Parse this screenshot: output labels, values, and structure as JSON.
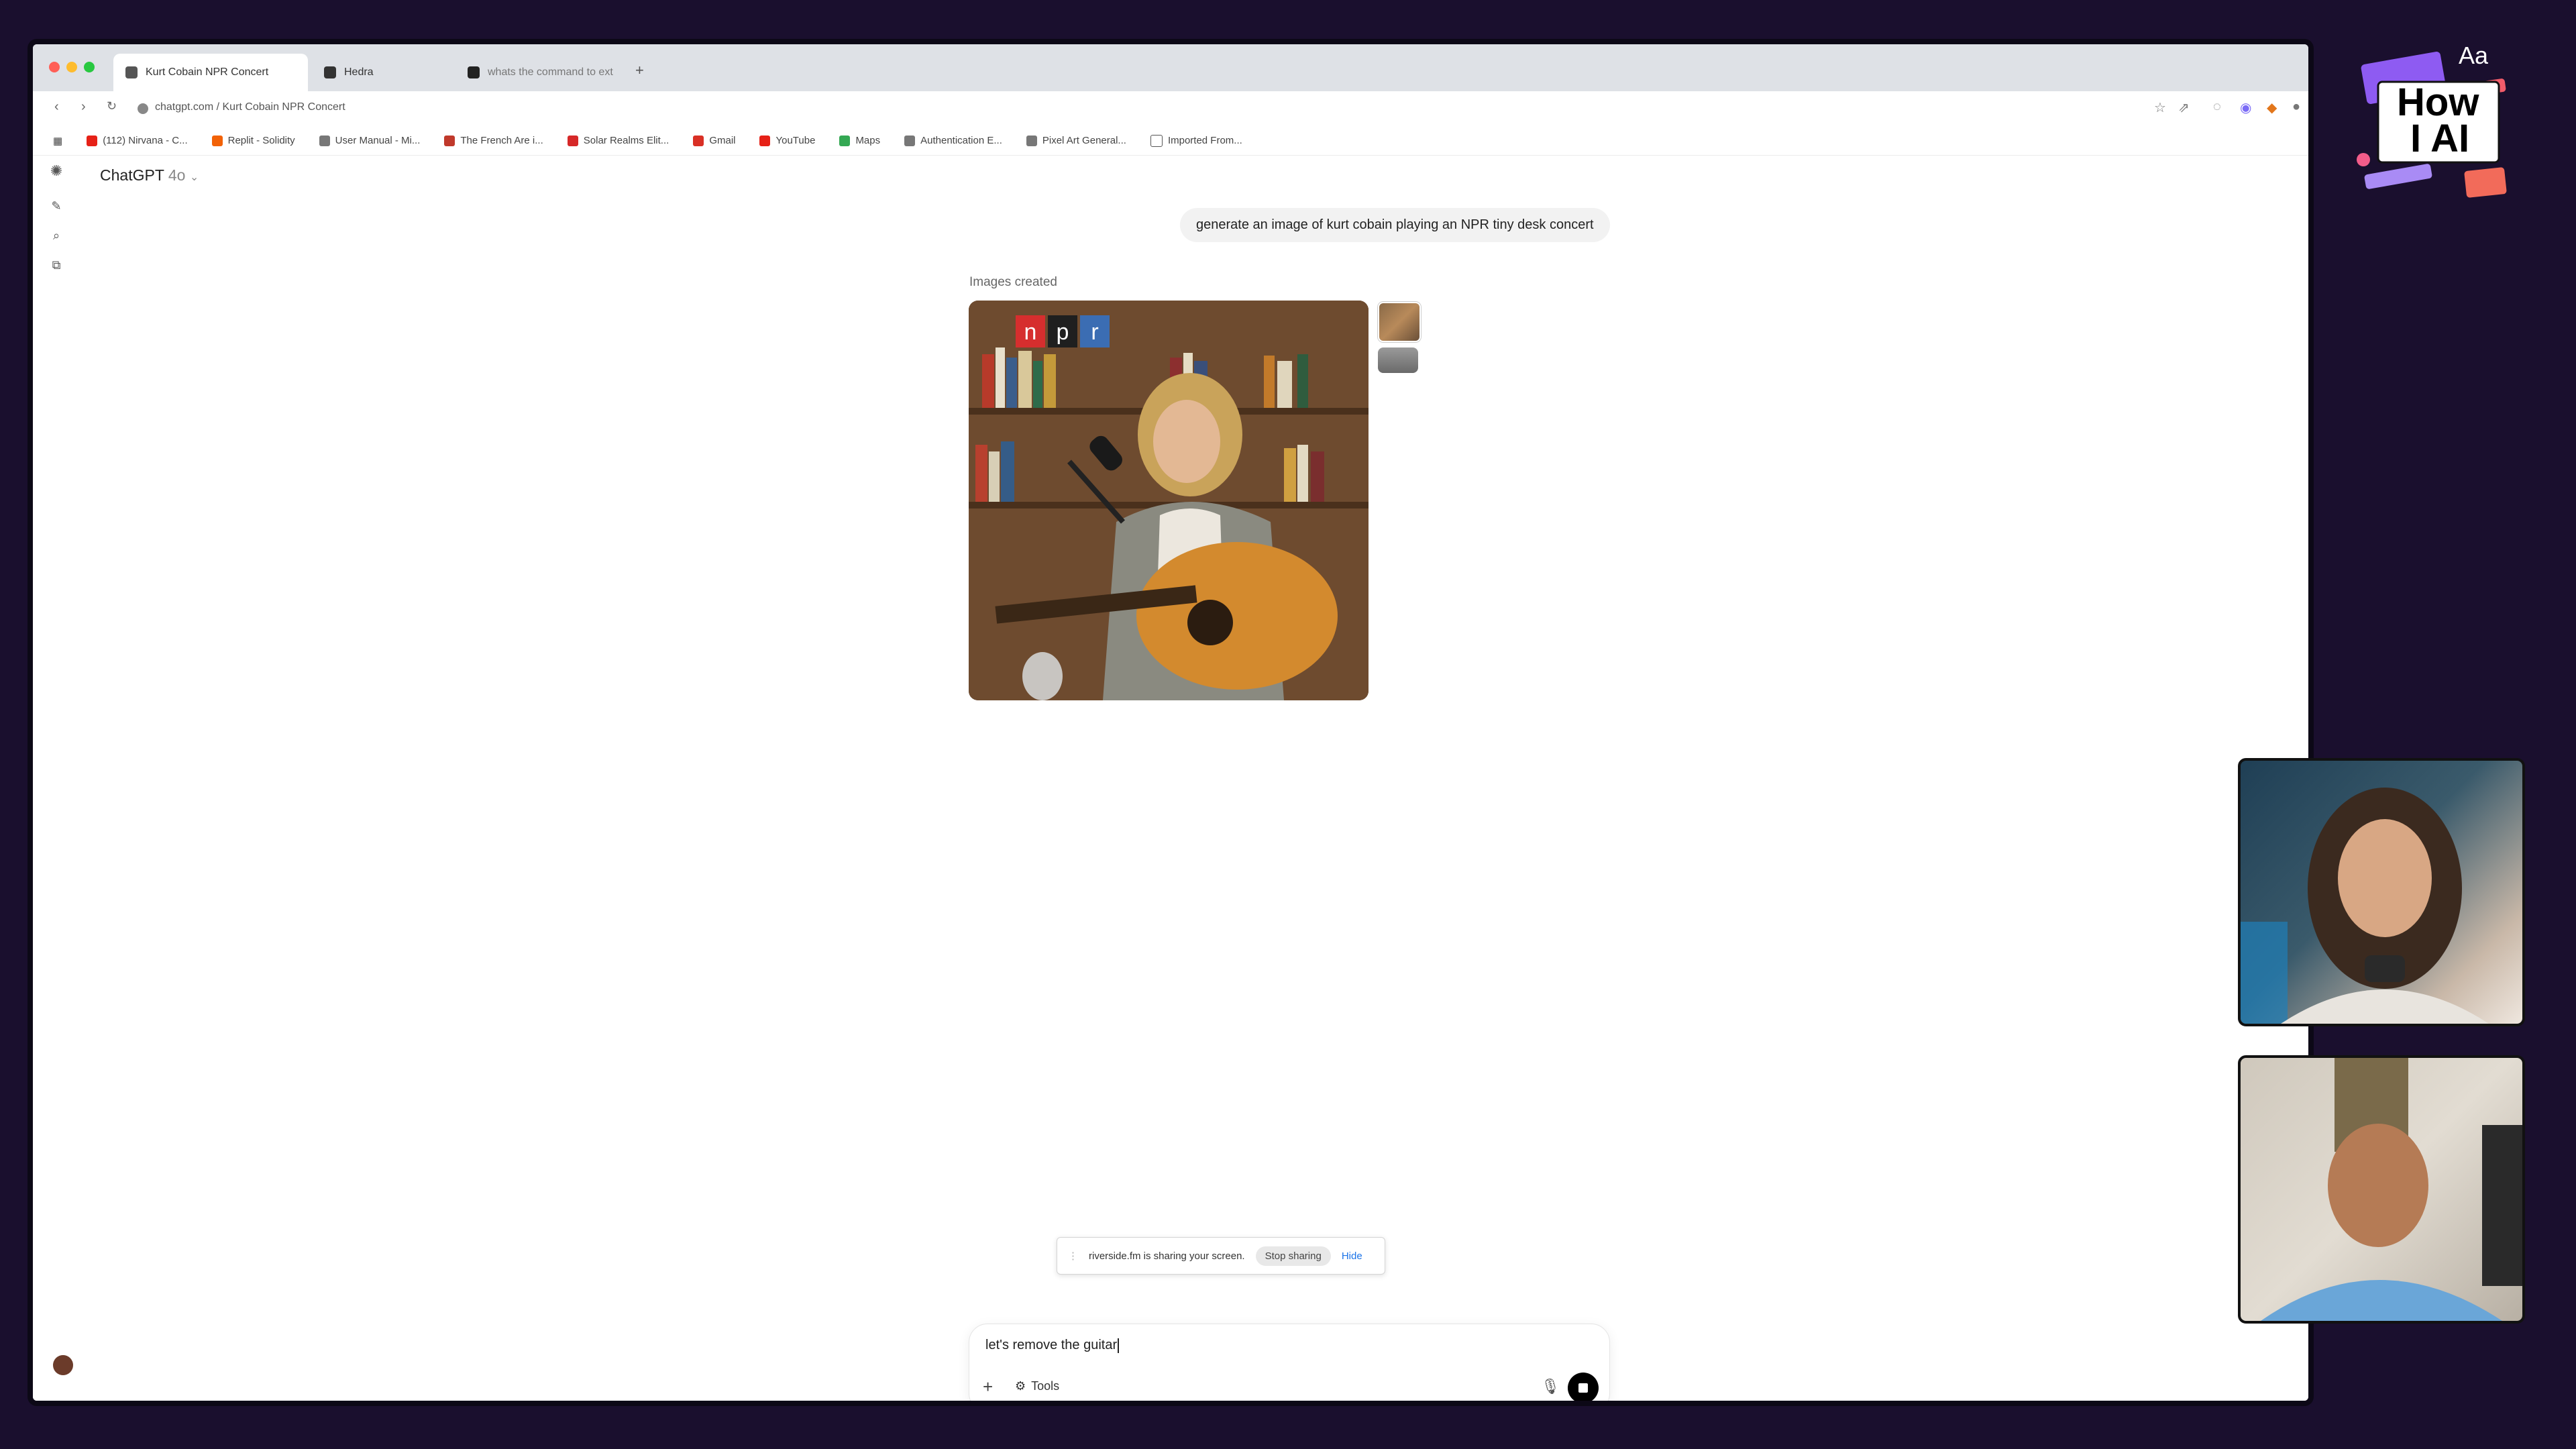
{
  "browser": {
    "tabs": [
      {
        "label": "Kurt Cobain NPR Concert",
        "active": true
      },
      {
        "label": "Hedra",
        "active": false
      },
      {
        "label": "whats the command to ext",
        "active": false
      }
    ],
    "url": "chatgpt.com / Kurt Cobain NPR Concert",
    "bookmarks": [
      {
        "label": "(112) Nirvana - C...",
        "icon": "youtube-icon",
        "color": "#e62117"
      },
      {
        "label": "Replit - Solidity",
        "icon": "replit-icon",
        "color": "#f26207"
      },
      {
        "label": "User Manual - Mi...",
        "icon": "globe-icon",
        "color": "#777777"
      },
      {
        "label": "The French Are i...",
        "icon": "bookmark-icon",
        "color": "#c0392b"
      },
      {
        "label": "Solar Realms Elit...",
        "icon": "star-icon",
        "color": "#d62828"
      },
      {
        "label": "Gmail",
        "icon": "gmail-icon",
        "color": "#d93025"
      },
      {
        "label": "YouTube",
        "icon": "youtube-icon",
        "color": "#e62117"
      },
      {
        "label": "Maps",
        "icon": "maps-icon",
        "color": "#34a853"
      },
      {
        "label": "Authentication E...",
        "icon": "globe-icon",
        "color": "#777777"
      },
      {
        "label": "Pixel Art General...",
        "icon": "globe-icon",
        "color": "#777777"
      },
      {
        "label": "Imported From...",
        "icon": "folder-icon",
        "color": "#555555"
      }
    ]
  },
  "chat": {
    "model_name": "ChatGPT",
    "model_version": "4o",
    "user_message": "generate an image of kurt cobain playing an NPR tiny desk concert",
    "images_label": "Images created",
    "npr_sign": "n p r",
    "composer_text": "let's remove the guitar",
    "tools_label": "Tools"
  },
  "screen_share": {
    "message": "riverside.fm is sharing your screen.",
    "stop_label": "Stop sharing",
    "hide_label": "Hide"
  },
  "logo": {
    "line1": "How",
    "line2": "I AI",
    "aa": "Aa"
  }
}
